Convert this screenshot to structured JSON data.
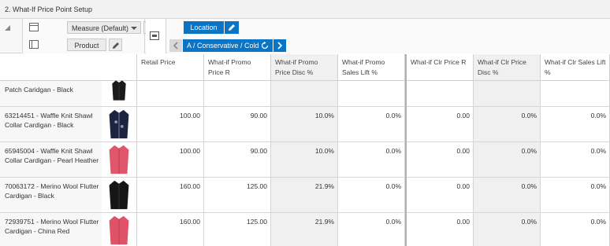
{
  "window": {
    "title": "2. What-If Price Point Setup"
  },
  "pivot": {
    "measure_label": "Measure (Default)",
    "product_label": "Product",
    "location_label": "Location",
    "attribute_label": "A / Conservative / Cold"
  },
  "columns": [
    "Retail Price",
    "What-if Promo Price R",
    "What-if Promo Price Disc %",
    "What-if Promo Sales Lift %",
    "What-if Clr Price R",
    "What-if Clr Price Disc %",
    "What-if Clr Sales Lift %"
  ],
  "rows": [
    {
      "label": "Patch Caridgan - Black",
      "image_color": "#1a1a1a",
      "values": [
        "",
        "",
        "",
        "",
        "",
        "",
        ""
      ]
    },
    {
      "label": "63214451 - Waffle Knit Shawl Collar Cardigan - Black",
      "image_color": "#1c2440",
      "values": [
        "100.00",
        "90.00",
        "10.0%",
        "0.0%",
        "0.00",
        "0.0%",
        "0.0%"
      ]
    },
    {
      "label": "65945004 - Waffle Knit Shawl Collar Cardigan - Pearl Heather",
      "image_color": "#e0566a",
      "values": [
        "100.00",
        "90.00",
        "10.0%",
        "0.0%",
        "0.00",
        "0.0%",
        "0.0%"
      ]
    },
    {
      "label": "70063172 - Merino Wool Flutter Cardigan - Black",
      "image_color": "#161616",
      "values": [
        "160.00",
        "125.00",
        "21.9%",
        "0.0%",
        "0.00",
        "0.0%",
        "0.0%"
      ]
    },
    {
      "label": "72939751 - Merino Wool Flutter Cardigan - China Red",
      "image_color": "#e05268",
      "values": [
        "160.00",
        "125.00",
        "21.9%",
        "0.0%",
        "0.00",
        "0.0%",
        "0.0%"
      ]
    }
  ]
}
